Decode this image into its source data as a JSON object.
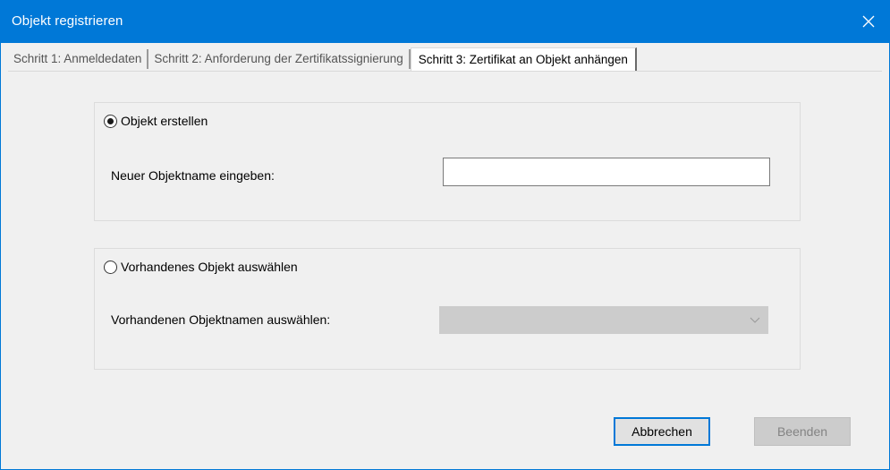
{
  "window": {
    "title": "Objekt registrieren",
    "close_label": "×"
  },
  "tabs": [
    {
      "label": "Schritt 1: Anmeldedaten",
      "active": false
    },
    {
      "label": "Schritt 2: Anforderung der Zertifikatssignierung",
      "active": false
    },
    {
      "label": "Schritt 3: Zertifikat an Objekt anhängen",
      "active": true
    }
  ],
  "create_group": {
    "radio_label": "Objekt erstellen",
    "selected": true,
    "name_label": "Neuer Objektname eingeben:",
    "name_value": ""
  },
  "existing_group": {
    "radio_label": "Vorhandenes Objekt auswählen",
    "selected": false,
    "select_label": "Vorhandenen Objektnamen auswählen:",
    "select_value": ""
  },
  "buttons": {
    "cancel": "Abbrechen",
    "finish": "Beenden"
  },
  "colors": {
    "accent": "#0078d7",
    "dialog_bg": "#f0f0f0",
    "disabled_bg": "#cccccc"
  },
  "icons": {
    "close": "close-icon",
    "dropdown": "chevron-down-icon"
  }
}
